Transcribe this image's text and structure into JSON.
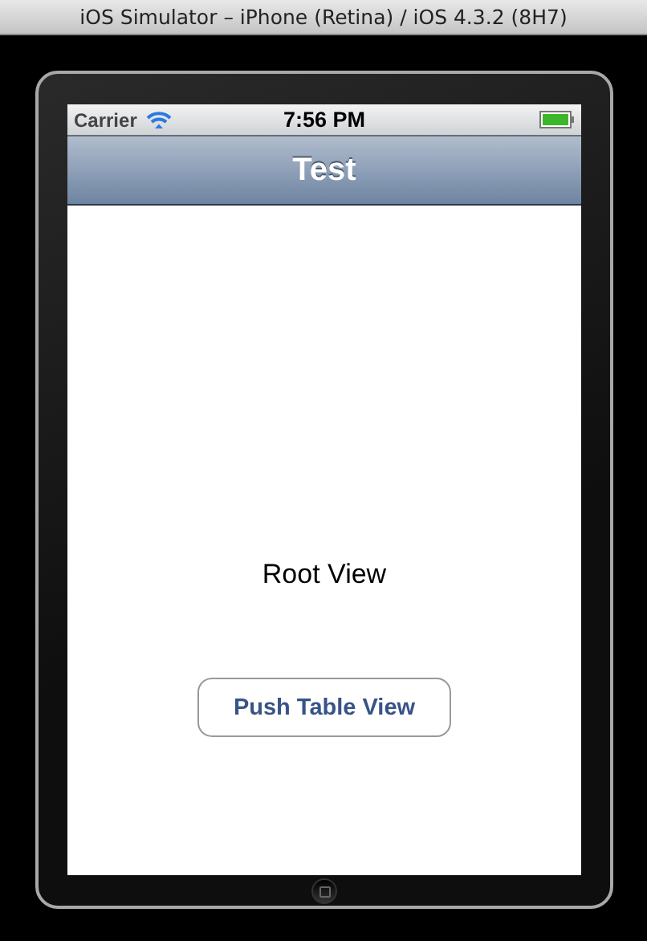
{
  "window": {
    "title": "iOS Simulator – iPhone (Retina) / iOS 4.3.2 (8H7)"
  },
  "status_bar": {
    "carrier": "Carrier",
    "time": "7:56 PM"
  },
  "nav_bar": {
    "title": "Test"
  },
  "content": {
    "label": "Root View",
    "button": "Push Table View"
  }
}
